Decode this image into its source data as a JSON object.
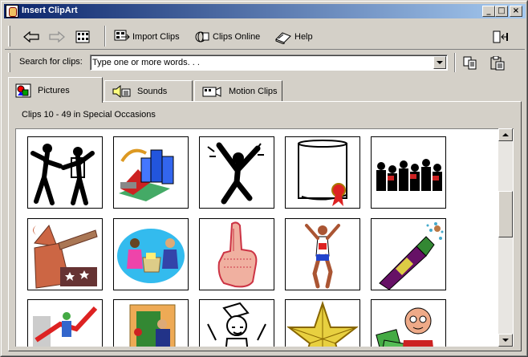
{
  "window": {
    "title": "Insert ClipArt",
    "minimize_glyph": "_",
    "maximize_glyph": "□",
    "close_glyph": "×"
  },
  "toolbar": {
    "back_icon": "back-arrow-icon",
    "forward_icon": "forward-arrow-icon",
    "all_categories_icon": "all-categories-icon",
    "import_clips_label": "Import Clips",
    "clips_online_label": "Clips Online",
    "help_label": "Help",
    "change_window_size_icon": "change-window-size-icon"
  },
  "search": {
    "label": "Search for clips:",
    "value": "Type one or more words. . .",
    "copy_icon": "copy-icon",
    "paste_icon": "paste-icon"
  },
  "tabs": [
    {
      "label": "Pictures",
      "icon": "pictures-icon",
      "active": true
    },
    {
      "label": "Sounds",
      "icon": "sounds-icon",
      "active": false
    },
    {
      "label": "Motion Clips",
      "icon": "motion-clips-icon",
      "active": false
    }
  ],
  "panel": {
    "caption": "Clips 10 - 49 in Special Occasions"
  },
  "clips": [
    {
      "name": "dancing-couple-clip"
    },
    {
      "name": "blocks-and-figure-clip"
    },
    {
      "name": "cheering-figure-clip"
    },
    {
      "name": "diploma-scroll-clip"
    },
    {
      "name": "applauding-crowd-clip"
    },
    {
      "name": "wizard-telescope-clip"
    },
    {
      "name": "business-meeting-clip"
    },
    {
      "name": "number-one-finger-clip"
    },
    {
      "name": "marathon-runner-clip"
    },
    {
      "name": "champagne-bottle-clip"
    },
    {
      "name": "growth-chart-clip"
    },
    {
      "name": "office-doorway-clip"
    },
    {
      "name": "party-man-clip"
    },
    {
      "name": "gold-star-clip"
    },
    {
      "name": "money-man-clip"
    }
  ],
  "colors": {
    "title_gradient_start": "#0a246a",
    "title_gradient_end": "#a6caf0",
    "face": "#d4d0c8"
  }
}
